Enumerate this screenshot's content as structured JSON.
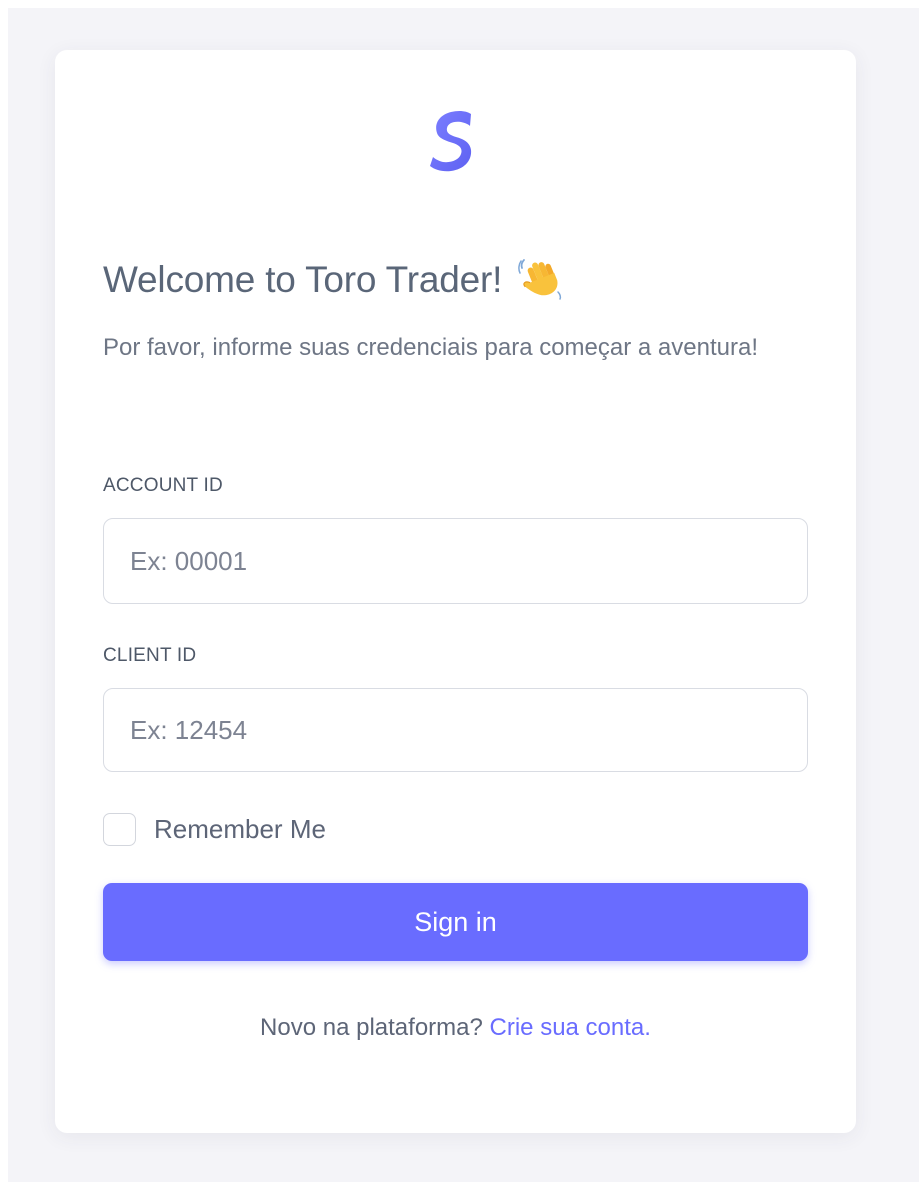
{
  "brand": {
    "logo_icon": "brand-s-logo-icon",
    "accent_color": "#696cff"
  },
  "header": {
    "title": "Welcome to Toro Trader!",
    "title_icon": "waving-hand-icon",
    "subtitle": "Por favor, informe suas credenciais para começar a aventura!"
  },
  "form": {
    "account_id": {
      "label": "ACCOUNT ID",
      "placeholder": "Ex: 00001",
      "value": ""
    },
    "client_id": {
      "label": "CLIENT ID",
      "placeholder": "Ex: 12454",
      "value": ""
    },
    "remember_me": {
      "label": "Remember Me",
      "checked": false
    },
    "submit_label": "Sign in"
  },
  "footer": {
    "prompt": "Novo na plataforma?",
    "link_text": "Crie sua conta."
  }
}
